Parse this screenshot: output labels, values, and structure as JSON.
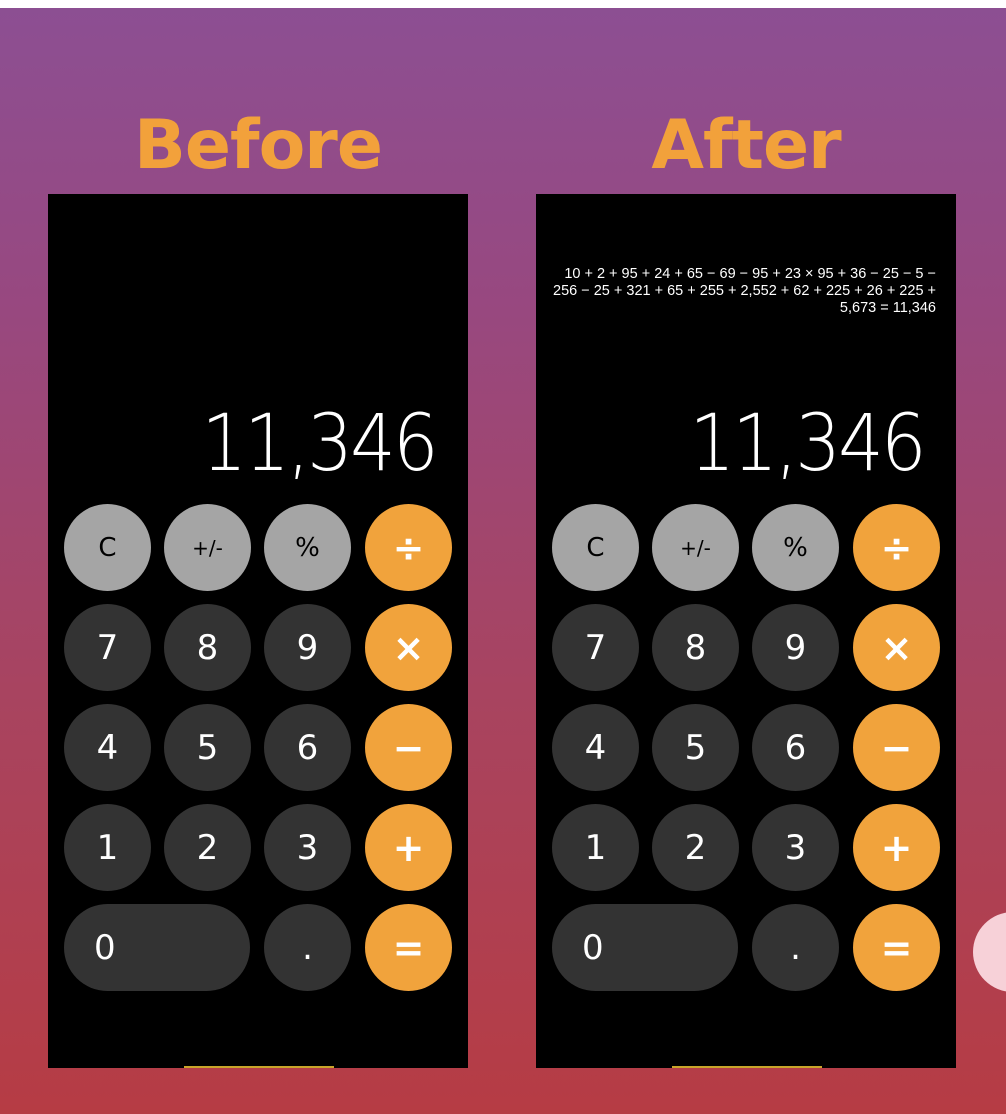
{
  "colors": {
    "title": "#f2a13b",
    "operator_key": "#f1a33c",
    "function_key": "#a5a5a5",
    "number_key": "#333333",
    "screen": "#000000"
  },
  "before": {
    "title": "Before",
    "display": "11,346",
    "keys": {
      "clear": "C",
      "sign": "+/-",
      "percent": "%",
      "divide": "÷",
      "seven": "7",
      "eight": "8",
      "nine": "9",
      "multiply": "×",
      "four": "4",
      "five": "5",
      "six": "6",
      "minus": "−",
      "one": "1",
      "two": "2",
      "three": "3",
      "plus": "+",
      "zero": "0",
      "decimal": ".",
      "equals": "="
    }
  },
  "after": {
    "title": "After",
    "history": "10 + 2 + 95 + 24 + 65 − 69 − 95 + 23 × 95 + 36 − 25 − 5 − 256 − 25 + 321 + 65 + 255 + 2,552 + 62 + 225 + 26 + 225 + 5,673 = 11,346",
    "display": "11,346",
    "keys": {
      "clear": "C",
      "sign": "+/-",
      "percent": "%",
      "divide": "÷",
      "seven": "7",
      "eight": "8",
      "nine": "9",
      "multiply": "×",
      "four": "4",
      "five": "5",
      "six": "6",
      "minus": "−",
      "one": "1",
      "two": "2",
      "three": "3",
      "plus": "+",
      "zero": "0",
      "decimal": ".",
      "equals": "="
    }
  }
}
